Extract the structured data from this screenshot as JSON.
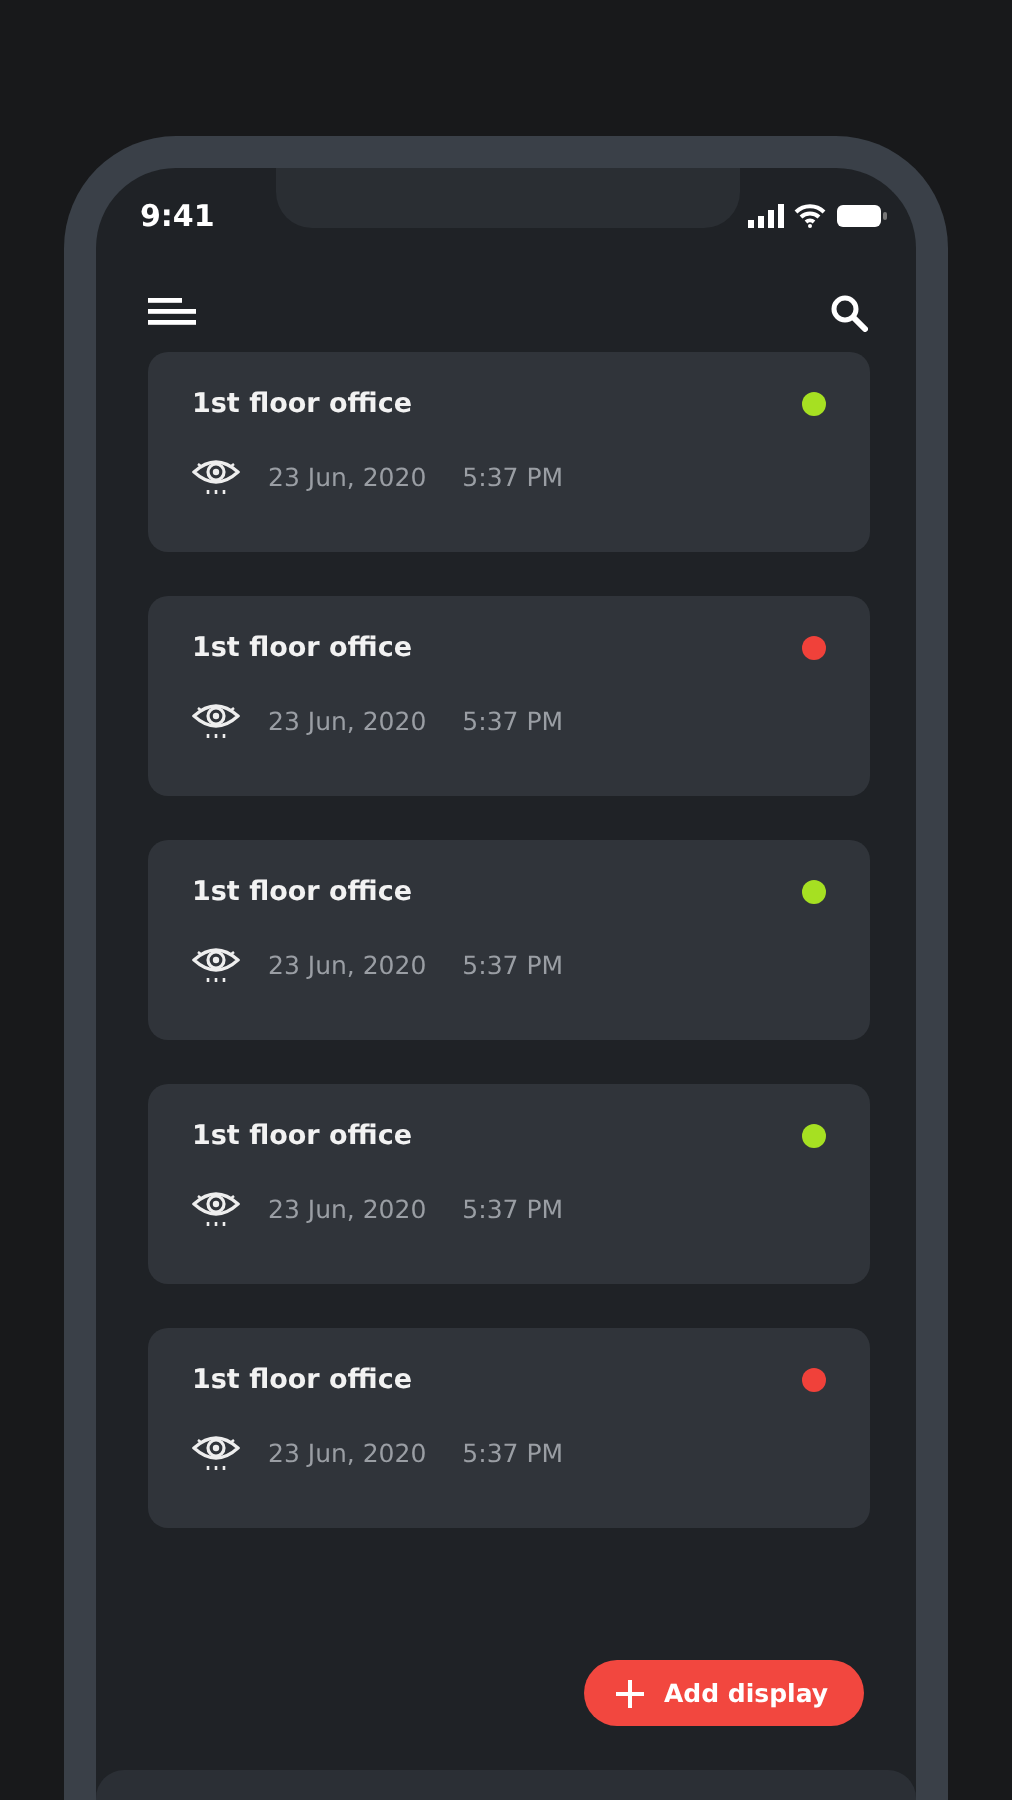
{
  "status_bar": {
    "time": "9:41"
  },
  "displays": [
    {
      "name": "1st floor office",
      "date": "23 Jun, 2020",
      "time": "5:37 PM",
      "color": "#a6e022"
    },
    {
      "name": "1st floor office",
      "date": "23 Jun, 2020",
      "time": "5:37 PM",
      "color": "#f0413a"
    },
    {
      "name": "1st floor office",
      "date": "23 Jun, 2020",
      "time": "5:37 PM",
      "color": "#a6e022"
    },
    {
      "name": "1st floor office",
      "date": "23 Jun, 2020",
      "time": "5:37 PM",
      "color": "#a6e022"
    },
    {
      "name": "1st floor office",
      "date": "23 Jun, 2020",
      "time": "5:37 PM",
      "color": "#f0413a"
    }
  ],
  "add_button": {
    "label": "Add display"
  }
}
